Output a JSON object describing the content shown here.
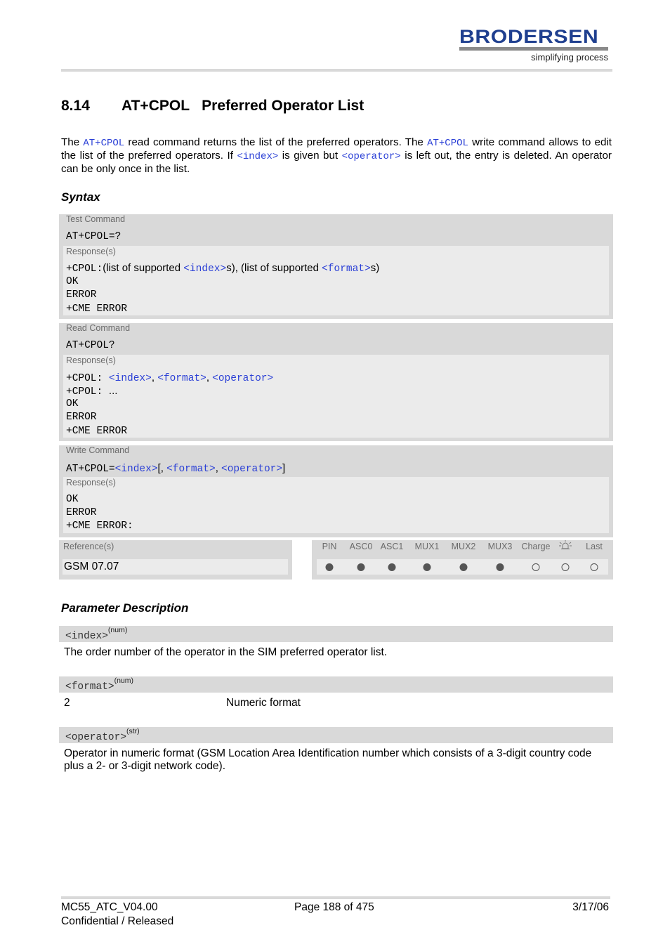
{
  "header": {
    "logo_text": "BRODERSEN",
    "logo_tagline": "simplifying process",
    "brand_color": "#1f3f8f"
  },
  "section": {
    "number": "8.14",
    "title": "AT+CPOL   Preferred Operator List"
  },
  "intro": {
    "p1_a": "The ",
    "p1_cmd1": "AT+CPOL",
    "p1_b": " read command returns the list of the preferred operators. The ",
    "p1_cmd2": "AT+CPOL",
    "p1_c": " write command allows to edit the list of the preferred operators. If ",
    "p1_param1": "<index>",
    "p1_d": " is given but ",
    "p1_param2": "<operator>",
    "p1_e": " is left out, the entry is deleted. An operator can be only once in the list."
  },
  "syntax": {
    "heading": "Syntax",
    "response_label": "Response(s)",
    "test": {
      "label": "Test Command",
      "command": "AT+CPOL=?",
      "resp_prefix": "+CPOL:",
      "resp_t1": "(list of supported ",
      "resp_p1": "<index>",
      "resp_t2": "s), (list of supported ",
      "resp_p2": "<format>",
      "resp_t3": "s)",
      "lines": [
        "OK",
        "ERROR",
        "+CME ERROR"
      ]
    },
    "read": {
      "label": "Read Command",
      "command": "AT+CPOL?",
      "resp_prefix": "+CPOL: ",
      "resp_p1": "<index>",
      "sep1": ", ",
      "resp_p2": "<format>",
      "sep2": ", ",
      "resp_p3": "<operator>",
      "line2_prefix": "+CPOL: ",
      "line2_text": "...",
      "lines": [
        "OK",
        "ERROR",
        "+CME ERROR"
      ]
    },
    "write": {
      "label": "Write Command",
      "cmd_prefix": "AT+CPOL=",
      "cmd_p1": "<index>",
      "cmd_t1": "[, ",
      "cmd_p2": "<format>",
      "cmd_t2": ", ",
      "cmd_p3": "<operator>",
      "cmd_t3": "]",
      "lines": [
        "OK",
        "ERROR",
        "+CME ERROR:"
      ]
    },
    "reference": {
      "label": "Reference(s)",
      "value": "GSM 07.07"
    },
    "availability": {
      "columns": [
        {
          "label": "PIN",
          "supported": true
        },
        {
          "label": "ASC0",
          "supported": true
        },
        {
          "label": "ASC1",
          "supported": true
        },
        {
          "label": "MUX1",
          "supported": true
        },
        {
          "label": "MUX2",
          "supported": true
        },
        {
          "label": "MUX3",
          "supported": true
        },
        {
          "label": "Charge",
          "supported": false
        },
        {
          "label": "alarm-icon",
          "supported": false
        },
        {
          "label": "Last",
          "supported": false
        }
      ]
    }
  },
  "parameters": {
    "heading": "Parameter Description",
    "items": [
      {
        "name": "<index>",
        "type": "(num)",
        "description": "The order number of the operator in the SIM preferred operator list."
      },
      {
        "name": "<format>",
        "type": "(num)",
        "value": "2",
        "value_description": "Numeric format"
      },
      {
        "name": "<operator>",
        "type": "(str)",
        "description_l1": "Operator in numeric format (GSM Location Area Identification number which consists of a 3-digit country code",
        "description_l2": "plus a 2- or 3-digit network code)."
      }
    ]
  },
  "footer": {
    "doc_id": "MC55_ATC_V04.00",
    "page": "Page 188 of 475",
    "date": "3/17/06",
    "status": "Confidential / Released"
  }
}
